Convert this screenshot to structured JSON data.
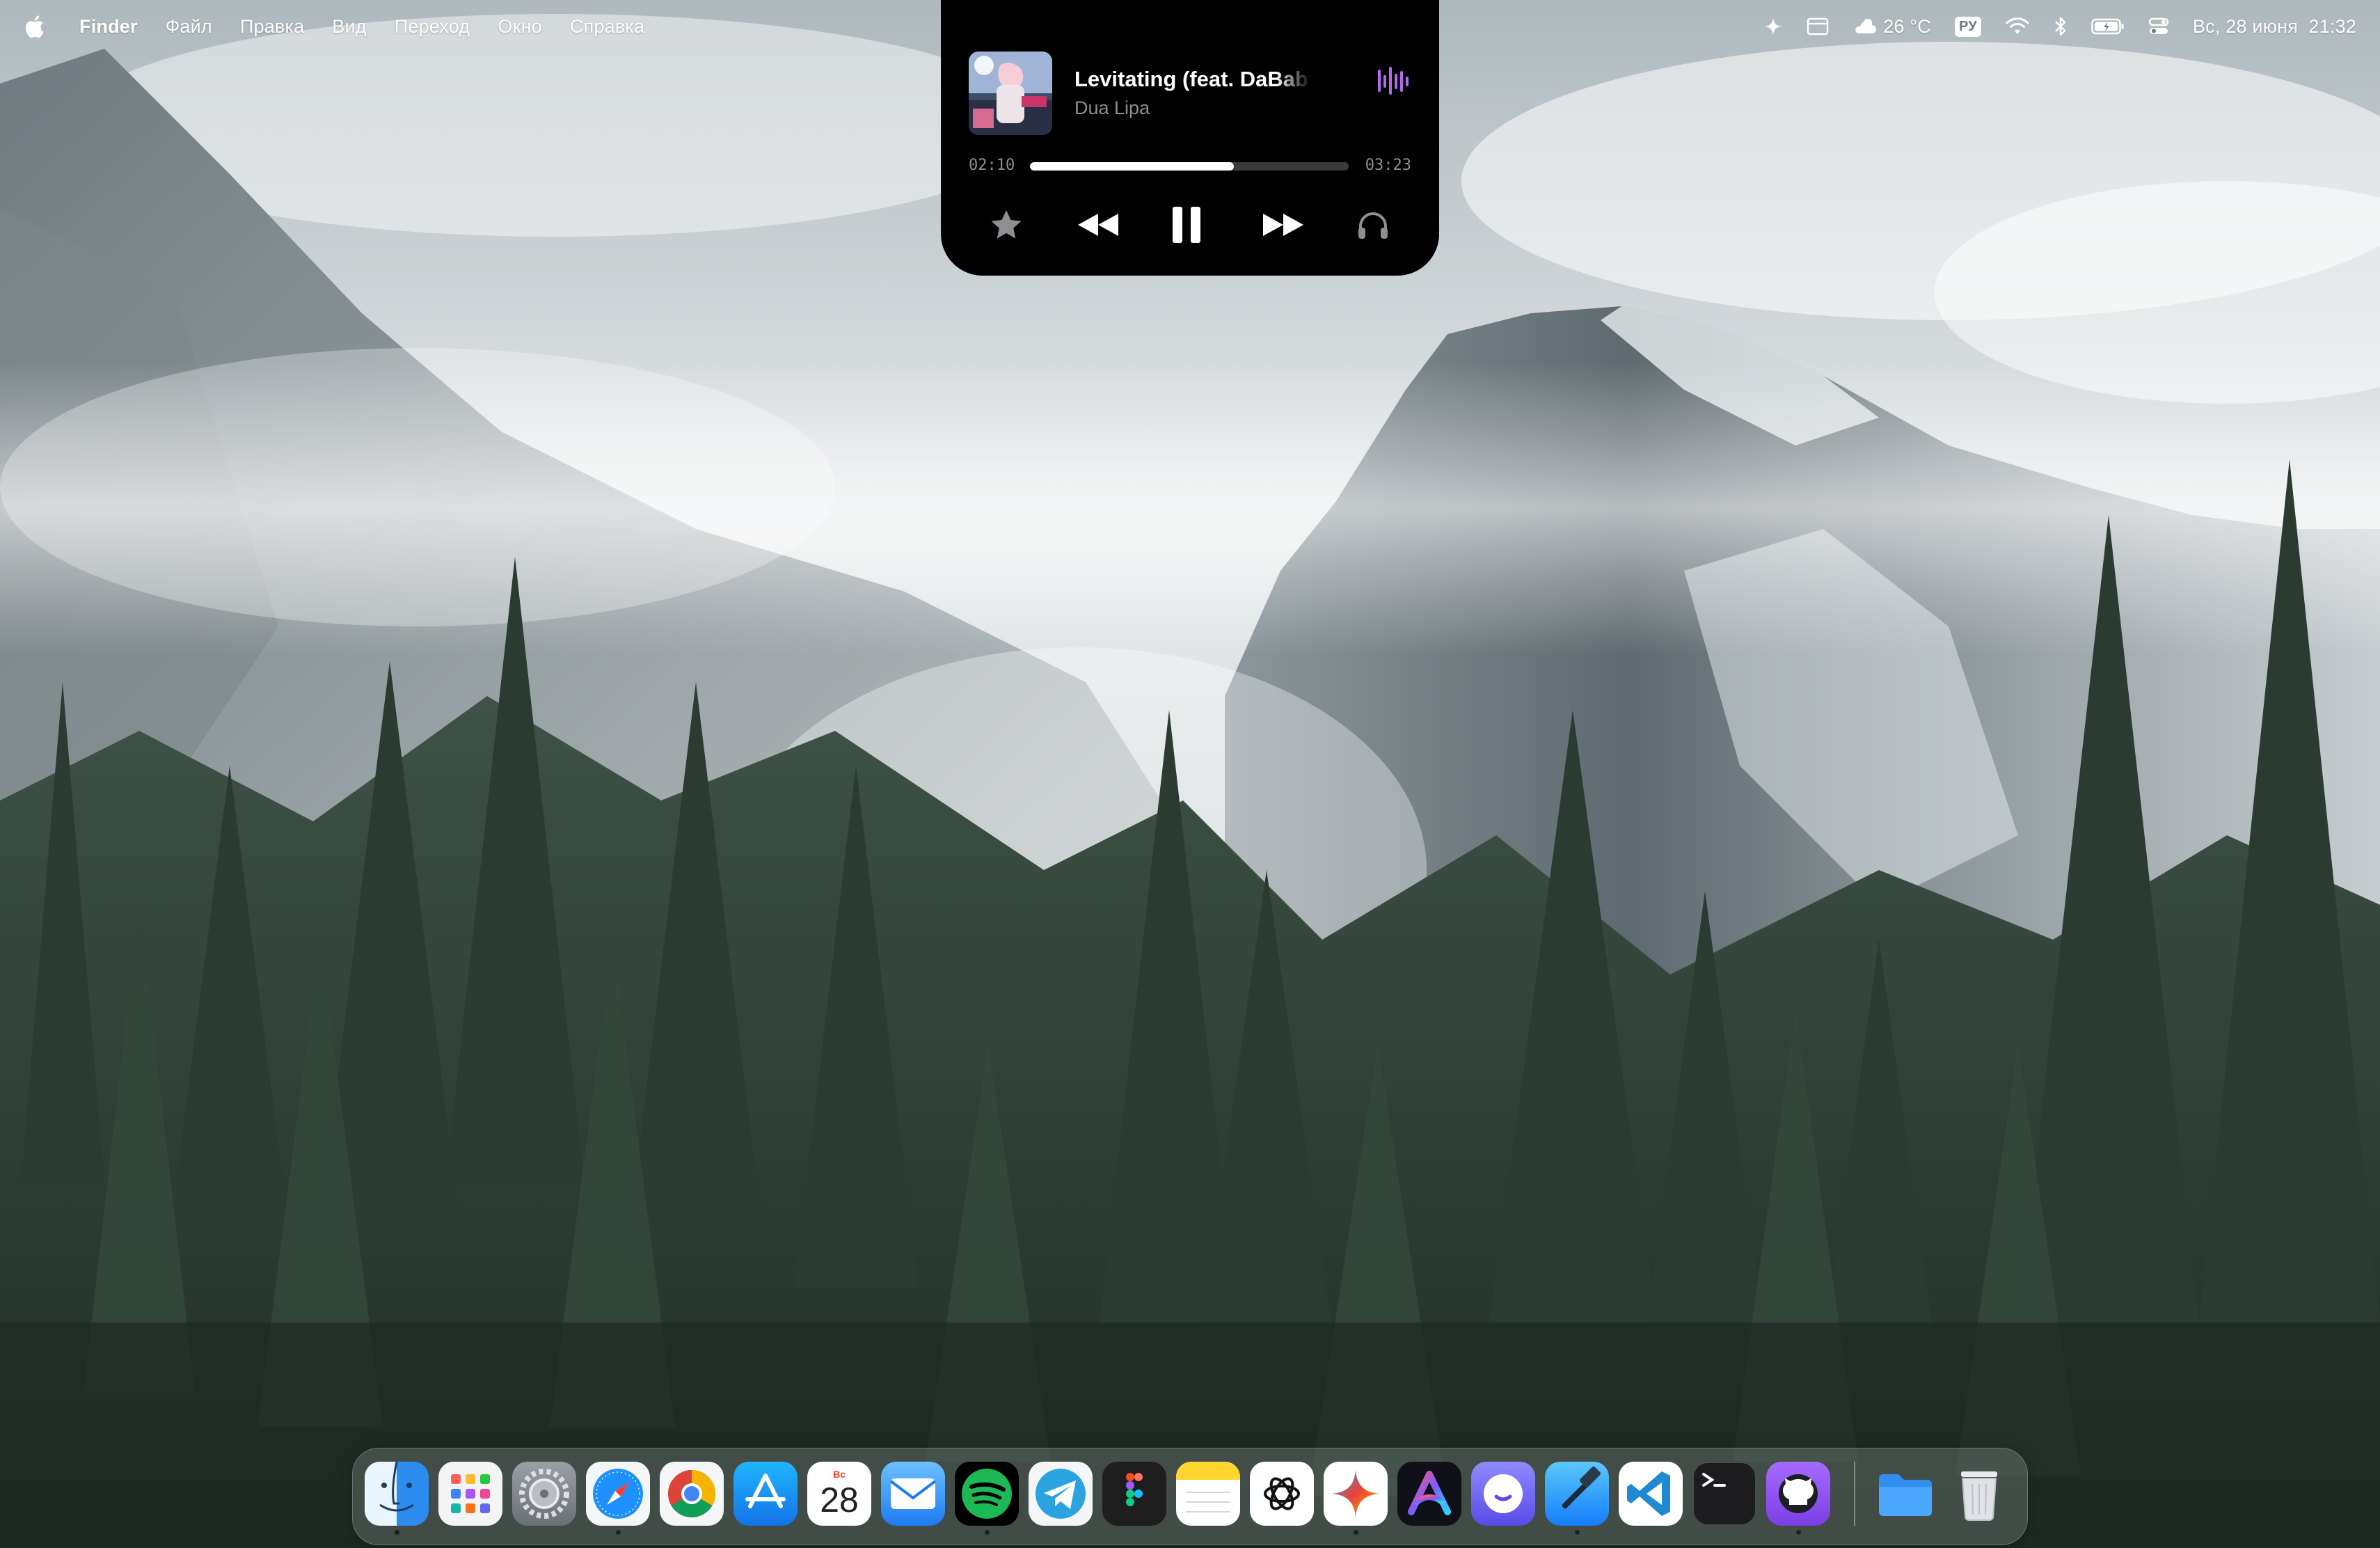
{
  "menubar": {
    "app_name": "Finder",
    "items": [
      "Файл",
      "Правка",
      "Вид",
      "Переход",
      "Окно",
      "Справка"
    ],
    "status": {
      "weather": "26 °C",
      "input_source": "РУ",
      "datetime": "Вс, 28 июня  21:32"
    },
    "icons": [
      "apple-logo-icon",
      "sparkle-icon",
      "window-icon",
      "weather-cloud-icon",
      "input-source-icon",
      "wifi-icon",
      "bluetooth-icon",
      "battery-icon",
      "control-center-icon"
    ]
  },
  "now_playing": {
    "title": "Levitating (feat. DaBaby)",
    "artist": "Dua Lipa",
    "elapsed": "02:10",
    "duration": "03:23",
    "progress": 0.64,
    "controls": [
      "star-icon",
      "rewind-icon",
      "pause-icon",
      "fast-forward-icon",
      "headphones-icon"
    ]
  },
  "dock": {
    "calendar": {
      "month": "Вс",
      "day": "28"
    },
    "apps": [
      "Finder",
      "Launchpad",
      "System Settings",
      "Safari",
      "Chrome",
      "App Store",
      "Calendar",
      "Mail",
      "Spotify",
      "Telegram",
      "Figma",
      "Notes",
      "ChatGPT",
      "Gemini",
      "Arc",
      "Setapp",
      "Xcode",
      "VS Code",
      "Terminal",
      "GitHub Desktop",
      "Downloads",
      "Trash"
    ],
    "running": [
      "Finder",
      "Safari",
      "Spotify",
      "Gemini",
      "Xcode",
      "GitHub Desktop"
    ]
  },
  "colors": {
    "accent": "#b469f0",
    "spotify": "#1db954",
    "progress": "#ffffff"
  }
}
